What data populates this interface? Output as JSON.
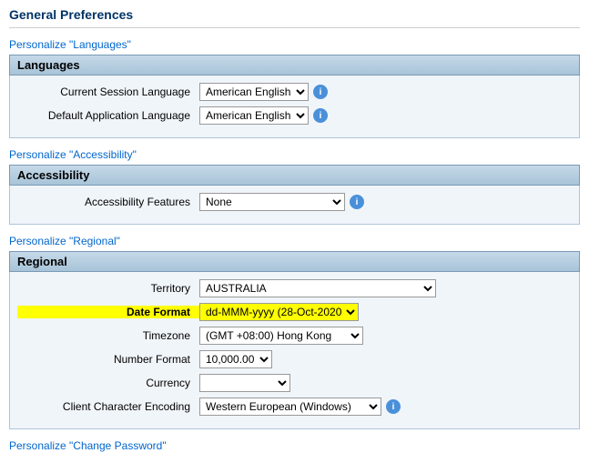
{
  "page": {
    "title": "General Preferences"
  },
  "languages_section": {
    "header": "Languages",
    "personalize_link": "Personalize \"Languages\"",
    "current_session_label": "Current Session Language",
    "default_app_label": "Default Application Language",
    "language_options": [
      "American English"
    ],
    "current_session_value": "American English",
    "default_app_value": "American English"
  },
  "accessibility_section": {
    "header": "Accessibility",
    "personalize_link": "Personalize \"Accessibility\"",
    "features_label": "Accessibility Features",
    "features_options": [
      "None"
    ],
    "features_value": "None"
  },
  "regional_section": {
    "header": "Regional",
    "personalize_link": "Personalize \"Regional\"",
    "territory_label": "Territory",
    "territory_value": "AUSTRALIA",
    "territory_options": [
      "AUSTRALIA"
    ],
    "date_format_label": "Date Format",
    "date_format_value": "dd-MMM-yyyy (28-Oct-2020)",
    "date_format_options": [
      "dd-MMM-yyyy (28-Oct-2020)"
    ],
    "timezone_label": "Timezone",
    "timezone_value": "(GMT +08:00) Hong Kong",
    "timezone_options": [
      "(GMT +08:00) Hong Kong"
    ],
    "number_format_label": "Number Format",
    "number_format_value": "10,000.00",
    "number_format_options": [
      "10,000.00"
    ],
    "currency_label": "Currency",
    "currency_value": "",
    "currency_options": [
      ""
    ],
    "encoding_label": "Client Character Encoding",
    "encoding_value": "Western European (Windows)",
    "encoding_options": [
      "Western European (Windows)"
    ]
  },
  "change_password": {
    "personalize_link": "Personalize \"Change Password\""
  },
  "icons": {
    "info": "i"
  }
}
